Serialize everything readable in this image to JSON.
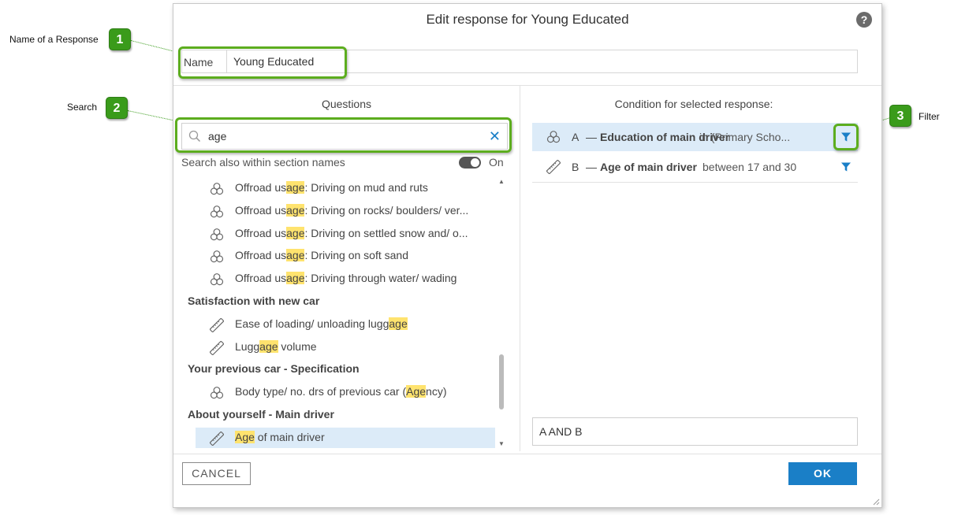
{
  "callouts": [
    {
      "number": "1",
      "label": "Name of a Response"
    },
    {
      "number": "2",
      "label": "Search"
    },
    {
      "number": "3",
      "label": "Filter"
    }
  ],
  "dialog": {
    "title": "Edit response for Young Educated",
    "help_icon": "question-mark-icon",
    "name_label": "Name",
    "name_value": "Young Educated"
  },
  "questions_panel": {
    "heading": "Questions",
    "search_value": "age",
    "search_icon": "magnifier-icon",
    "clear_icon": "close-icon",
    "section_names_label": "Search also within section names",
    "section_names_toggle": "On",
    "rows": [
      {
        "kind": "item",
        "icon": "multi-choice-icon",
        "pre": "Offroad us",
        "match": "age",
        "post": ": Driving on mud and ruts"
      },
      {
        "kind": "item",
        "icon": "multi-choice-icon",
        "pre": "Offroad us",
        "match": "age",
        "post": ": Driving on rocks/ boulders/ ver..."
      },
      {
        "kind": "item",
        "icon": "multi-choice-icon",
        "pre": "Offroad us",
        "match": "age",
        "post": ": Driving on settled snow and/ o..."
      },
      {
        "kind": "item",
        "icon": "multi-choice-icon",
        "pre": "Offroad us",
        "match": "age",
        "post": ": Driving on soft sand"
      },
      {
        "kind": "item",
        "icon": "multi-choice-icon",
        "pre": "Offroad us",
        "match": "age",
        "post": ": Driving through water/ wading"
      },
      {
        "kind": "group",
        "label": "Satisfaction with new car"
      },
      {
        "kind": "item",
        "icon": "ruler-icon",
        "pre": "Ease of loading/ unloading lugg",
        "match": "age",
        "post": ""
      },
      {
        "kind": "item",
        "icon": "ruler-icon",
        "pre": "Lugg",
        "match": "age",
        "post": " volume"
      },
      {
        "kind": "group",
        "label": "Your previous car - Specification"
      },
      {
        "kind": "item",
        "icon": "multi-choice-icon",
        "pre": "Body type/ no. drs of previous car (",
        "match": "Age",
        "post": "ncy)"
      },
      {
        "kind": "group",
        "label": "About yourself - Main driver"
      },
      {
        "kind": "item",
        "icon": "ruler-icon",
        "pre": "",
        "match": "Age",
        "post": " of main driver",
        "selected": true
      }
    ]
  },
  "condition_panel": {
    "heading": "Condition for selected response:",
    "conditions": [
      {
        "icon": "multi-choice-icon",
        "letter": "A",
        "dash": "—",
        "question": "Education of main driver",
        "criteria": "in (Primary Scho...",
        "filter_icon": "funnel-icon",
        "active": true
      },
      {
        "icon": "ruler-icon",
        "letter": "B",
        "dash": "—",
        "question": "Age of main driver",
        "criteria": "between 17 and 30",
        "filter_icon": "funnel-icon",
        "active": false
      }
    ],
    "expression": "A AND B"
  },
  "footer": {
    "cancel_label": "CANCEL",
    "ok_label": "OK"
  },
  "colors": {
    "accent": "#1a7fc7",
    "callout_green": "#3a9b1b",
    "highlight": "#ffe36e",
    "selection": "#dcebf8"
  }
}
